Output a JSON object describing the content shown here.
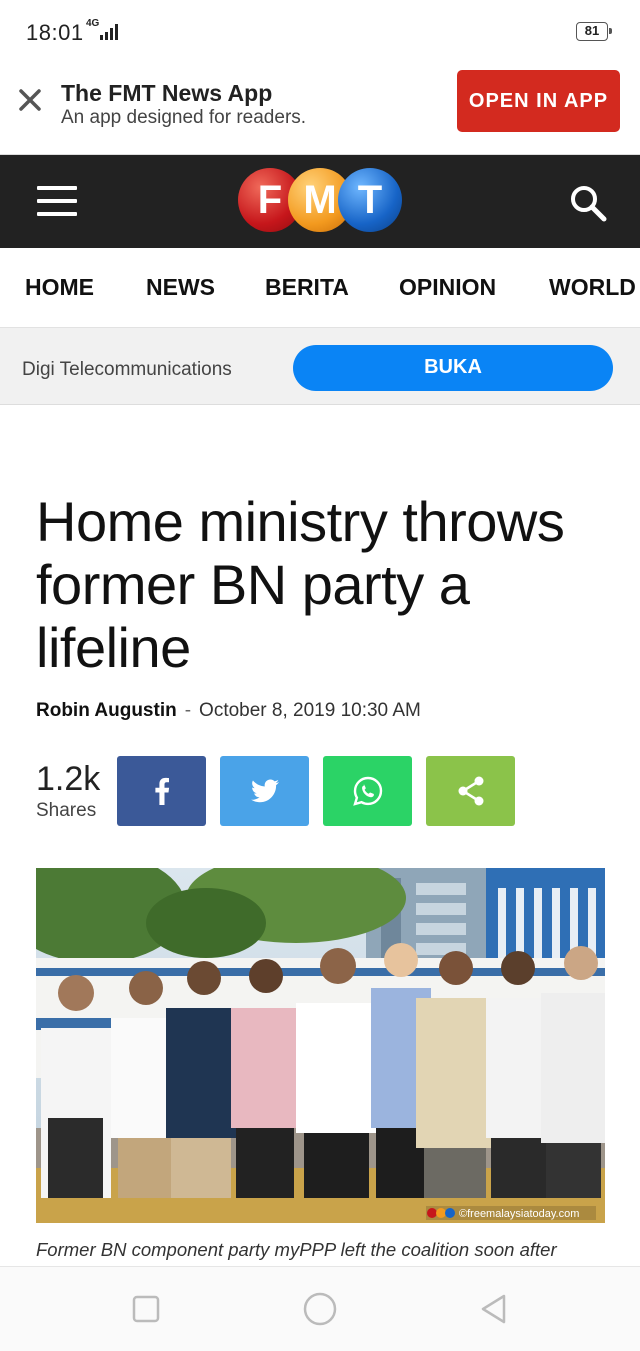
{
  "status_bar": {
    "time": "18:01",
    "network": "4G",
    "battery": "81"
  },
  "app_banner": {
    "close_icon": "close-icon",
    "title": "The FMT News App",
    "subtitle": "An app designed for readers.",
    "open_label": "OPEN IN APP"
  },
  "header": {
    "logo_letters": [
      "F",
      "M",
      "T"
    ],
    "menu_icon": "hamburger-icon",
    "search_icon": "search-icon"
  },
  "nav": {
    "items": [
      "HOME",
      "NEWS",
      "BERITA",
      "OPINION",
      "WORLD"
    ]
  },
  "ad": {
    "name": "Digi Telecommunications",
    "button": "BUKA"
  },
  "article": {
    "headline": "Home ministry throws former BN party a lifeline",
    "author": "Robin Augustin",
    "separator": "-",
    "date": "October 8, 2019 10:30 AM",
    "share_count": "1.2k",
    "share_label": "Shares",
    "watermark": "©freemalaysiatoday.com",
    "caption": "Former BN component party myPPP left the coalition soon after"
  },
  "share_buttons": [
    {
      "name": "facebook",
      "icon": "facebook-icon",
      "color": "#3b5998"
    },
    {
      "name": "twitter",
      "icon": "twitter-icon",
      "color": "#4aa3e8"
    },
    {
      "name": "whatsapp",
      "icon": "whatsapp-icon",
      "color": "#2bd366"
    },
    {
      "name": "share",
      "icon": "share-icon",
      "color": "#8bc34a"
    }
  ],
  "colors": {
    "brand_red": "#d32a1f",
    "header_bg": "#222222",
    "ad_button": "#0a84f5"
  }
}
